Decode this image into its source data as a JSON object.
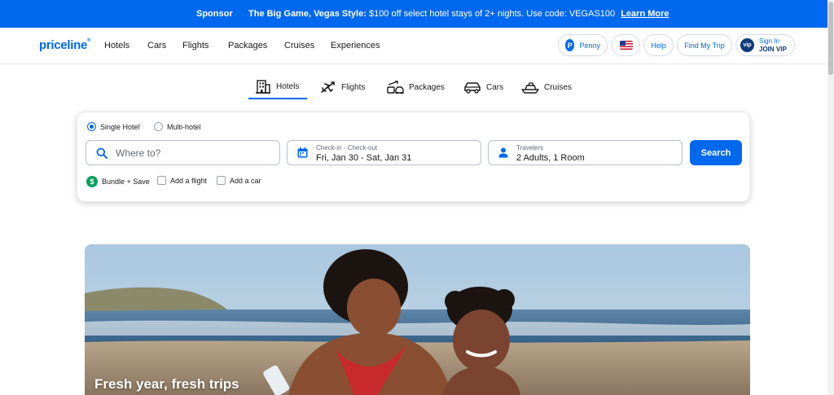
{
  "banner": {
    "sponsor": "Sponsor",
    "headline": "The Big Game, Vegas Style:",
    "message": "$100 off select hotel stays of 2+ nights. Use code: VEGAS100",
    "link": "Learn More"
  },
  "header": {
    "logo": "priceline",
    "nav": [
      "Hotels",
      "Cars",
      "Flights",
      "Packages",
      "Cruises",
      "Experiences"
    ],
    "penny": "Penny",
    "help": "Help",
    "find_trip": "Find My Trip",
    "vip_badge": "vip",
    "sign_in": "Sign In",
    "join_vip": "JOIN VIP"
  },
  "tabs": [
    {
      "label": "Hotels",
      "icon": "hotel-icon",
      "active": true
    },
    {
      "label": "Flights",
      "icon": "plane-icon",
      "active": false
    },
    {
      "label": "Packages",
      "icon": "package-icon",
      "active": false
    },
    {
      "label": "Cars",
      "icon": "car-icon",
      "active": false
    },
    {
      "label": "Cruises",
      "icon": "ship-icon",
      "active": false
    }
  ],
  "search": {
    "single_hotel": "Single Hotel",
    "multi_hotel": "Multi-hotel",
    "where_placeholder": "Where to?",
    "dates_label": "Check-in - Check-out",
    "dates_value": "Fri, Jan 30 - Sat, Jan 31",
    "travelers_label": "Travelers",
    "travelers_value": "2 Adults, 1 Room",
    "button": "Search",
    "bundle_icon": "$",
    "bundle": "Bundle + Save",
    "add_flight": "Add a flight",
    "add_car": "Add a car"
  },
  "hero": {
    "title": "Fresh year, fresh trips"
  },
  "colors": {
    "brand": "#0068ef",
    "bundle_green": "#08a05c",
    "vip_navy": "#0a3a7a"
  }
}
